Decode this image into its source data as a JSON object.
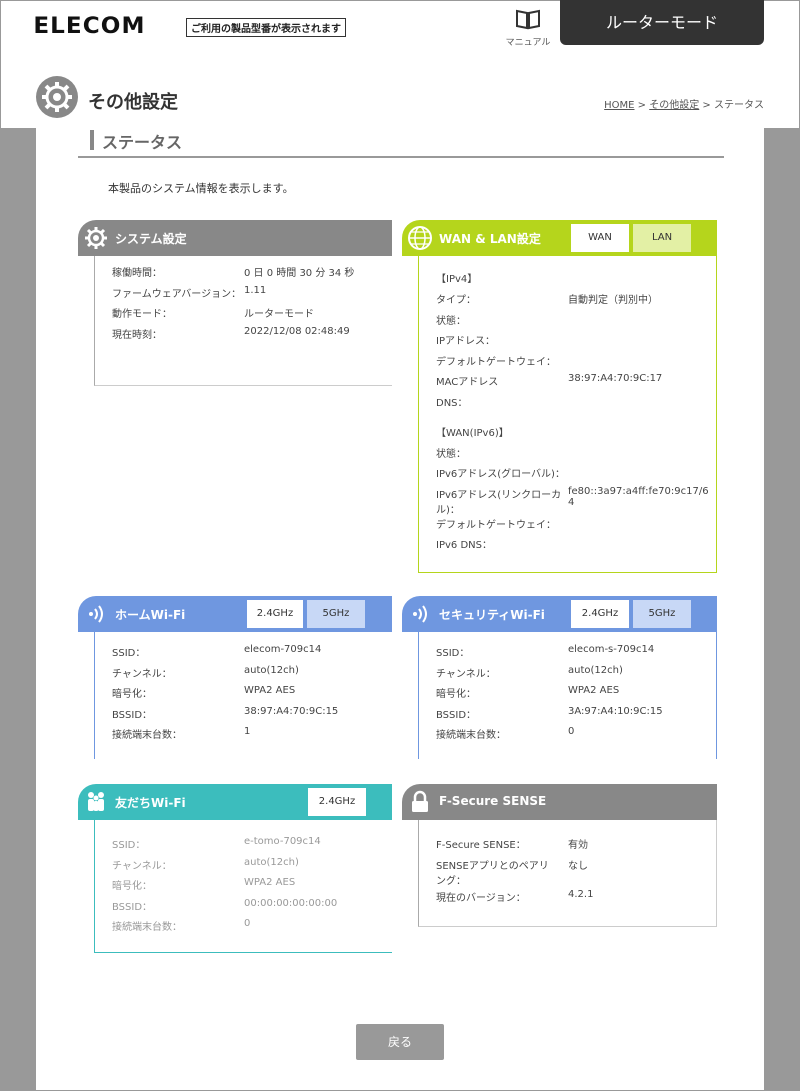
{
  "header": {
    "logo": "ELECOM",
    "model_notice": "ご利用の製品型番が表示されます",
    "manual_label": "マニュアル",
    "mode_label": "ルーターモード"
  },
  "page": {
    "title": "その他設定",
    "breadcrumb": {
      "home": "HOME",
      "sep1": " > ",
      "parent": "その他設定",
      "sep2": " > ",
      "current": "ステータス"
    },
    "section_title": "ステータス",
    "intro": "本製品のシステム情報を表示します。"
  },
  "system": {
    "title": "システム設定",
    "rows": [
      {
        "k": "稼働時間：",
        "v": "0 日 0 時間 30 分 34 秒"
      },
      {
        "k": "ファームウェアバージョン：",
        "v": "1.11"
      },
      {
        "k": "動作モード：",
        "v": "ルーターモード"
      },
      {
        "k": "現在時刻：",
        "v": "2022/12/08 02:48:49"
      }
    ]
  },
  "wan": {
    "title": "WAN & LAN設定",
    "tab_wan": "WAN",
    "tab_lan": "LAN",
    "ipv4_header": "【IPv4】",
    "ipv4_rows": [
      {
        "k": "タイプ：",
        "v": "自動判定（判別中）"
      },
      {
        "k": "状態：",
        "v": ""
      },
      {
        "k": "IPアドレス：",
        "v": ""
      },
      {
        "k": "デフォルトゲートウェイ：",
        "v": ""
      },
      {
        "k": "MACアドレス",
        "v": "38:97:A4:70:9C:17"
      },
      {
        "k": "DNS：",
        "v": ""
      }
    ],
    "ipv6_header": "【WAN(IPv6)】",
    "ipv6_rows": [
      {
        "k": "状態：",
        "v": ""
      },
      {
        "k": "IPv6アドレス(グローバル)：",
        "v": ""
      },
      {
        "k": "IPv6アドレス(リンクローカル)：",
        "v": "fe80::3a97:a4ff:fe70:9c17/64"
      },
      {
        "k": "デフォルトゲートウェイ：",
        "v": ""
      },
      {
        "k": "IPv6 DNS：",
        "v": ""
      }
    ]
  },
  "home_wifi": {
    "title": "ホームWi-Fi",
    "tab_24": "2.4GHz",
    "tab_5": "5GHz",
    "rows": [
      {
        "k": "SSID：",
        "v": "elecom-709c14"
      },
      {
        "k": "チャンネル：",
        "v": "auto(12ch)"
      },
      {
        "k": "暗号化：",
        "v": "WPA2 AES"
      },
      {
        "k": "BSSID：",
        "v": "38:97:A4:70:9C:15"
      },
      {
        "k": "接続端末台数：",
        "v": "1"
      }
    ]
  },
  "security_wifi": {
    "title": "セキュリティWi-Fi",
    "tab_24": "2.4GHz",
    "tab_5": "5GHz",
    "rows": [
      {
        "k": "SSID：",
        "v": "elecom-s-709c14"
      },
      {
        "k": "チャンネル：",
        "v": "auto(12ch)"
      },
      {
        "k": "暗号化：",
        "v": "WPA2 AES"
      },
      {
        "k": "BSSID：",
        "v": "3A:97:A4:10:9C:15"
      },
      {
        "k": "接続端末台数：",
        "v": "0"
      }
    ]
  },
  "friend_wifi": {
    "title": "友だちWi-Fi",
    "tab_24": "2.4GHz",
    "rows": [
      {
        "k": "SSID：",
        "v": "e-tomo-709c14"
      },
      {
        "k": "チャンネル：",
        "v": "auto(12ch)"
      },
      {
        "k": "暗号化：",
        "v": "WPA2 AES"
      },
      {
        "k": "BSSID：",
        "v": "00:00:00:00:00:00"
      },
      {
        "k": "接続端末台数：",
        "v": "0"
      }
    ]
  },
  "fsecure": {
    "title": "F-Secure SENSE",
    "rows": [
      {
        "k": "F-Secure SENSE：",
        "v": "有効"
      },
      {
        "k": "SENSEアプリとのペアリング：",
        "v": "なし"
      },
      {
        "k": "現在のバージョン：",
        "v": "4.2.1"
      }
    ]
  },
  "back_label": "戻る",
  "colors": {
    "wan": "#b5d51c",
    "wifi": "#6f97e0",
    "friend": "#3cbdbd",
    "gray": "#888888"
  }
}
